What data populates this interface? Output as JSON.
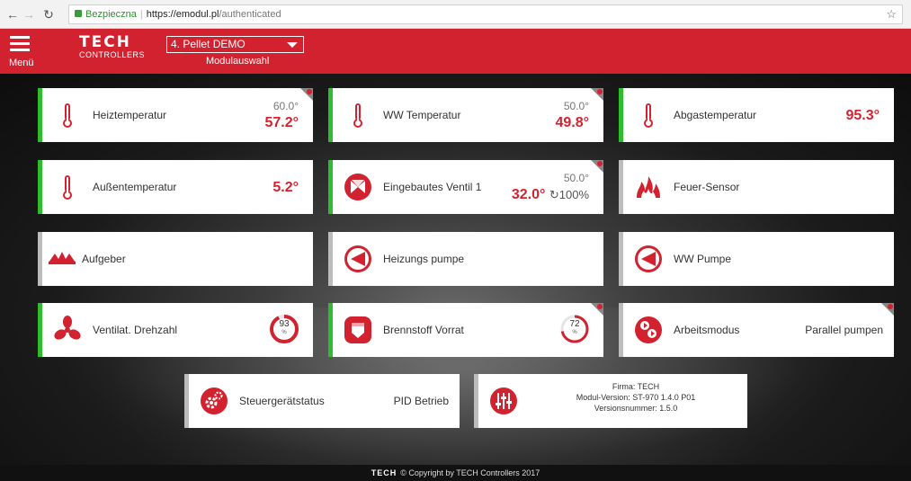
{
  "browser": {
    "secure_label": "Bezpieczna",
    "url_host": "https://emodul.pl",
    "url_path": "/authenticated"
  },
  "header": {
    "menu_label": "Menü",
    "logo_main": "TECH",
    "logo_sub": "CONTROLLERS",
    "module_selected": "4. Pellet DEMO",
    "module_label": "Modulauswahl"
  },
  "tiles": {
    "heiztemperatur": {
      "label": "Heiztemperatur",
      "set": "60.0°",
      "current": "57.2°"
    },
    "ww_temperatur": {
      "label": "WW Temperatur",
      "set": "50.0°",
      "current": "49.8°"
    },
    "abgastemperatur": {
      "label": "Abgastemperatur",
      "current": "95.3°"
    },
    "aussentemperatur": {
      "label": "Außentemperatur",
      "current": "5.2°"
    },
    "ventil": {
      "label": "Eingebautes Ventil 1",
      "set": "50.0°",
      "current": "32.0°",
      "opening": "100%"
    },
    "feuer": {
      "label": "Feuer-Sensor"
    },
    "aufgeber": {
      "label": "Aufgeber"
    },
    "heizungspumpe": {
      "label": "Heizungs pumpe"
    },
    "ww_pumpe": {
      "label": "WW Pumpe"
    },
    "ventilat": {
      "label": "Ventilat. Drehzahl",
      "value": "93",
      "unit": "%"
    },
    "brennstoff": {
      "label": "Brennstoff Vorrat",
      "value": "72",
      "unit": "%"
    },
    "arbeitsmodus": {
      "label": "Arbeitsmodus",
      "value": "Parallel pumpen"
    },
    "steuergeraet": {
      "label": "Steuergerätstatus",
      "value": "PID Betrieb"
    },
    "info": {
      "firma": "Firma: TECH",
      "modul_version": "Modul-Version: ST-970 1.4.0 P01",
      "versionsnummer": "Versionsnummer: 1.5.0"
    }
  },
  "gauges": {
    "ventilat_fraction": 0.93,
    "brennstoff_fraction": 0.72
  },
  "footer": {
    "logo": "TECH",
    "text": "© Copyright by TECH Controllers 2017"
  },
  "colors": {
    "accent_red": "#d3222f",
    "status_green": "#2ebd2e"
  },
  "icons": [
    "thermometer-icon",
    "valve-icon",
    "fire-icon",
    "feeder-icon",
    "pump-icon",
    "fan-icon",
    "fuel-icon",
    "mode-icon",
    "gears-icon",
    "sliders-icon"
  ]
}
